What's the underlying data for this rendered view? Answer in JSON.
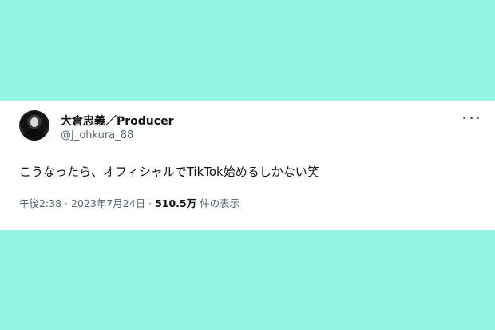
{
  "tweet": {
    "display_name": "大倉忠義／Producer",
    "handle": "@J_ohkura_88",
    "text": "こうなったら、オフィシャルでTikTok始めるしかない笑",
    "time": "午後2:38",
    "separator": " · ",
    "date": "2023年7月24日",
    "views_count": "510.5万",
    "views_label": " 件の表示"
  },
  "icons": {
    "avatar": "profile-photo",
    "more": "more-horizontal-icon"
  },
  "colors": {
    "background": "#95f5e4",
    "card": "#ffffff",
    "text_primary": "#0f1419",
    "text_secondary": "#536471"
  }
}
